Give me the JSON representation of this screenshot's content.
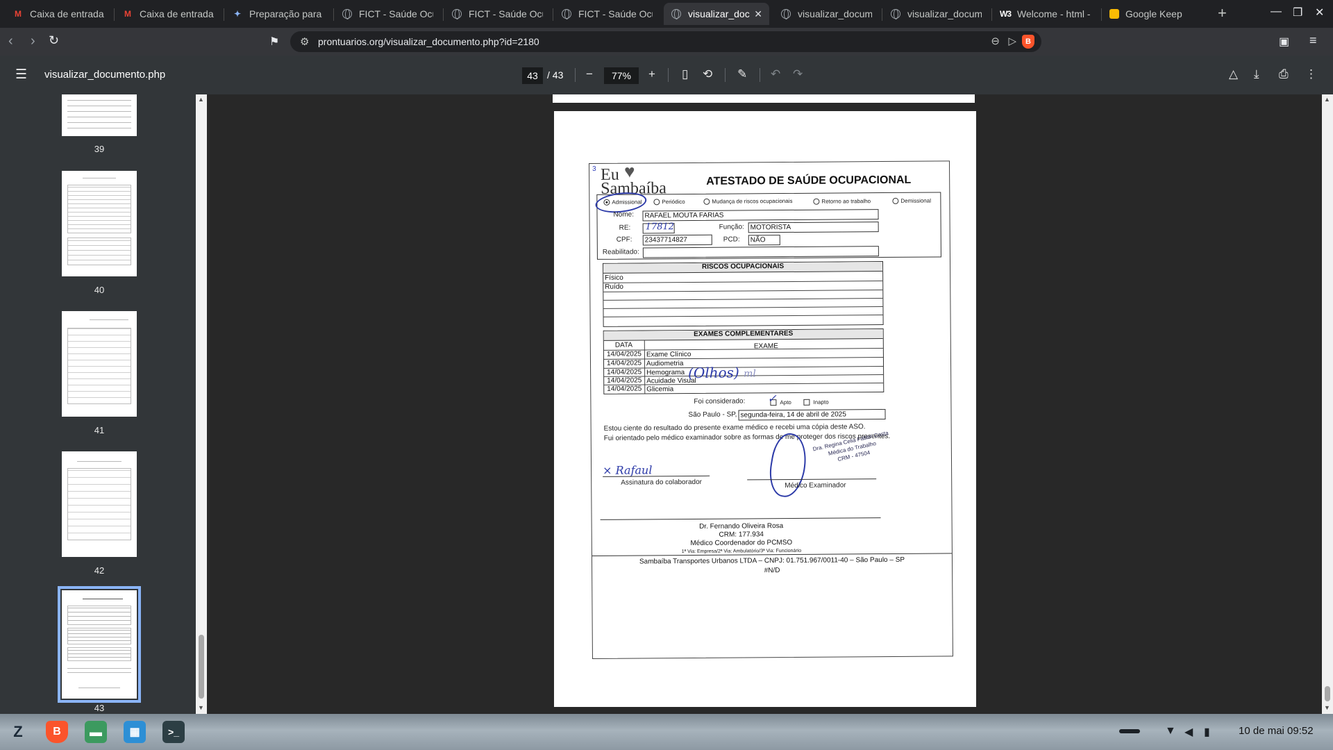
{
  "browser": {
    "tabs": [
      {
        "title": "Caixa de entrada",
        "icon": "gmail-icon",
        "glyph": "M"
      },
      {
        "title": "Caixa de entrada",
        "icon": "gmail-icon",
        "glyph": "M"
      },
      {
        "title": "Preparação para a",
        "icon": "gemini-icon",
        "glyph": "✦"
      },
      {
        "title": "FICT - Saúde Ocu",
        "icon": "globe-icon",
        "glyph": ""
      },
      {
        "title": "FICT - Saúde Ocu",
        "icon": "globe-icon",
        "glyph": ""
      },
      {
        "title": "FICT - Saúde Ocu",
        "icon": "globe-icon",
        "glyph": ""
      },
      {
        "title": "visualizar_doc",
        "icon": "globe-icon",
        "glyph": ""
      },
      {
        "title": "visualizar_docum",
        "icon": "globe-icon",
        "glyph": ""
      },
      {
        "title": "visualizar_docum",
        "icon": "globe-icon",
        "glyph": ""
      },
      {
        "title": "Welcome - html -",
        "icon": "w3schools-icon",
        "glyph": "W3"
      },
      {
        "title": "Google Keep",
        "icon": "keep-icon",
        "glyph": ""
      }
    ],
    "active_tab": 6,
    "close_glyph": "✕",
    "new_tab_glyph": "+",
    "url": "prontuarios.org/visualizar_documento.php?id=2180"
  },
  "pdf_viewer": {
    "filename": "visualizar_documento.php",
    "current_page": "43",
    "total_pages": "/ 43",
    "zoom": "77%",
    "thumbnails": [
      "39",
      "40",
      "41",
      "42",
      "43"
    ]
  },
  "document": {
    "logo_line1": "Eu",
    "logo_line2": "Sambaíba",
    "title": "ATESTADO DE SAÚDE OCUPACIONAL",
    "page_mark": "3",
    "exam_types": [
      "Admissional",
      "Periódico",
      "Mudança de riscos ocupacionais",
      "Retorno ao trabalho",
      "Demissional"
    ],
    "selected_exam_type": "Admissional",
    "labels": {
      "name": "Nome:",
      "re": "RE:",
      "function": "Função:",
      "cpf": "CPF:",
      "pcd": "PCD:",
      "rehab": "Reabilitado:"
    },
    "values": {
      "name": "RAFAEL MOUTA FARIAS",
      "re": "17812",
      "function": "MOTORISTA",
      "cpf": "23437714827",
      "pcd": "NÃO",
      "rehab": ""
    },
    "risks_header": "RISCOS OCUPACIONAIS",
    "risks": [
      "Físico",
      "Ruído",
      "",
      "",
      "",
      ""
    ],
    "exams_header": "EXAMES COMPLEMENTARES",
    "exam_col_date": "DATA",
    "exam_col_exam": "EXAME",
    "exams": [
      {
        "date": "14/04/2025",
        "exam": "Exame Clínico"
      },
      {
        "date": "14/04/2025",
        "exam": "Audiometria"
      },
      {
        "date": "14/04/2025",
        "exam": "Hemograma"
      },
      {
        "date": "14/04/2025",
        "exam": "Acuidade Visual"
      },
      {
        "date": "14/04/2025",
        "exam": "Glicemia"
      }
    ],
    "considered_label": "Foi considerado:",
    "fit_label": "Apto",
    "unfit_label": "Inapto",
    "place_label": "São Paulo - SP,",
    "date_value": "segunda-feira, 14 de abril de 2025",
    "statement1": "Estou ciente do resultado do presente exame médico e recebi uma cópia deste ASO.",
    "statement2": "Fui orientado pelo médico examinador sobre as formas de me proteger dos riscos presentes.",
    "sig_worker": "Assinatura do colaborador",
    "sig_doctor": "Médico Examinador",
    "stamp_line1": "Dra. Regina Celia Fabbri Costa",
    "stamp_line2": "Médica do Trabalho",
    "stamp_line3": "CRM - 47504",
    "coord_name": "Dr. Fernando Oliveira Rosa",
    "coord_crm": "CRM: 177.934",
    "coord_role": "Médico Coordenador do PCMSO",
    "copies": "1ª Via: Empresa/2ª Via: Ambulatório/3ª Via: Funcionário",
    "company": "Sambaíba Transportes Urbanos LTDA – CNPJ: 01.751.967/0011-40 – São Paulo – SP",
    "code": "#N/D",
    "handwriting_exam": "(Olhos)",
    "handwriting_exam2": "ml",
    "handwriting_re": "17812",
    "handwriting_sig": "× Rafaul"
  },
  "taskbar": {
    "clock": "10 de mai  09:52",
    "apps": [
      "zorin-menu-icon",
      "brave-icon",
      "files-icon",
      "store-icon",
      "terminal-icon"
    ]
  }
}
